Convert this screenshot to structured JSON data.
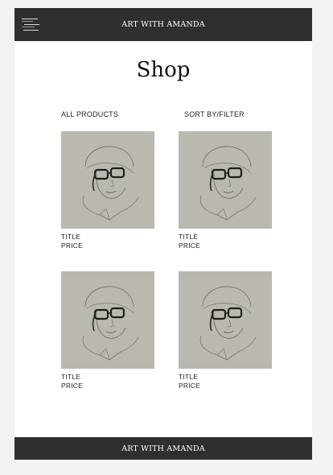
{
  "header": {
    "brand": "ART WITH AMANDA",
    "menu_icon": "hamburger-menu-icon"
  },
  "main": {
    "title": "Shop",
    "all_products_label": "ALL PRODUCTS",
    "sort_filter_label": "SORT BY/FILTER",
    "products": [
      {
        "title": "TITLE",
        "price": "PRICE",
        "image": "portrait-sketch-woman-glasses"
      },
      {
        "title": "TITLE",
        "price": "PRICE",
        "image": "portrait-sketch-woman-glasses"
      },
      {
        "title": "TITLE",
        "price": "PRICE",
        "image": "portrait-sketch-woman-glasses"
      },
      {
        "title": "TITLE",
        "price": "PRICE",
        "image": "portrait-sketch-woman-glasses"
      }
    ]
  },
  "footer": {
    "brand": "ART WITH AMANDA"
  },
  "colors": {
    "bar": "#2f2f2f",
    "background": "#f2f2f2",
    "panel": "#ffffff",
    "sketch_paper": "#b9b7ae"
  }
}
